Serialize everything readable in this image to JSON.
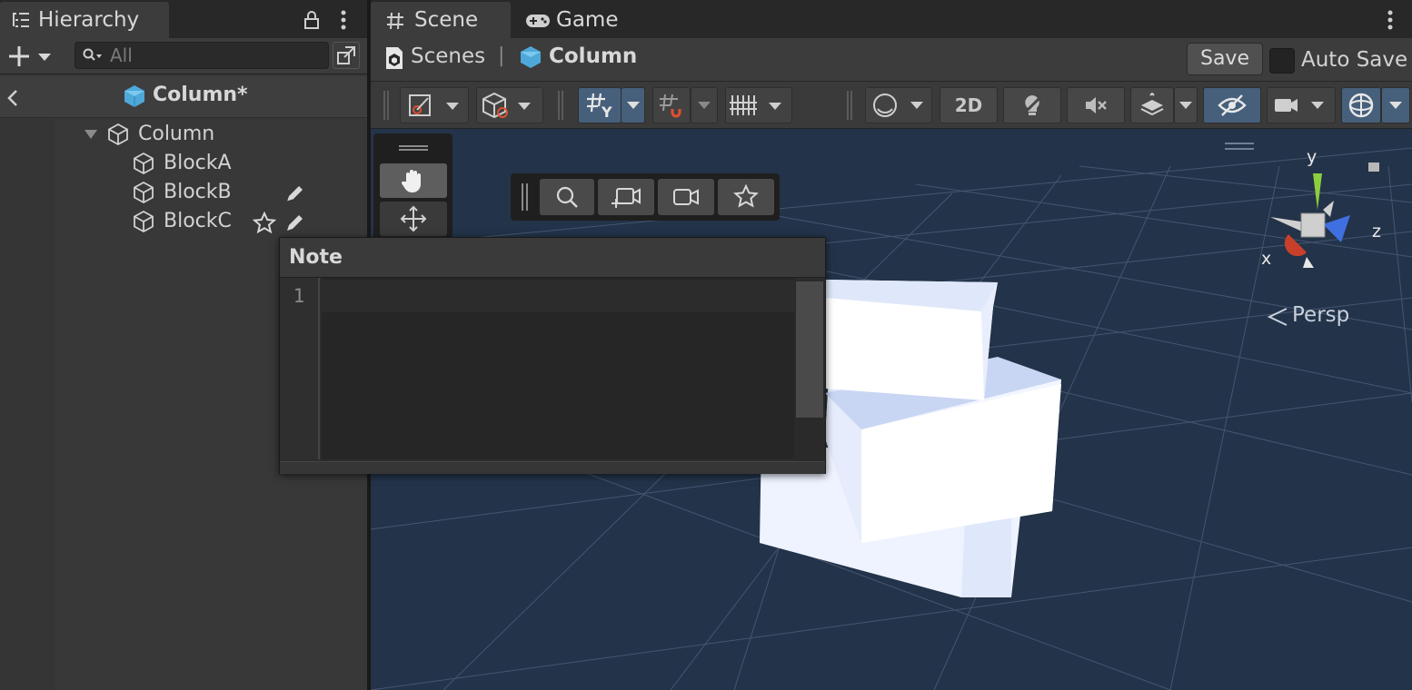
{
  "hierarchy": {
    "tab_label": "Hierarchy",
    "search_placeholder": "All",
    "scene_title": "Column*",
    "items": [
      {
        "label": "Column"
      },
      {
        "label": "BlockA"
      },
      {
        "label": "BlockB"
      },
      {
        "label": "BlockC"
      }
    ]
  },
  "scene_window": {
    "tabs": [
      {
        "label": "Scene"
      },
      {
        "label": "Game"
      }
    ],
    "breadcrumb": {
      "root": "Scenes",
      "separator": "|",
      "current": "Column"
    },
    "save_label": "Save",
    "auto_save_label": "Auto Save",
    "auto_save_checked": false,
    "toggle_2d_label": "2D",
    "gizmo": {
      "x": "x",
      "y": "y",
      "z": "z",
      "projection": "Persp"
    }
  },
  "note_panel": {
    "title": "Note",
    "line_number": "1",
    "content": ""
  },
  "colors": {
    "accent": "#46607c",
    "prefab_blue": "#5cb8e8",
    "scene_bg": "#233349"
  }
}
